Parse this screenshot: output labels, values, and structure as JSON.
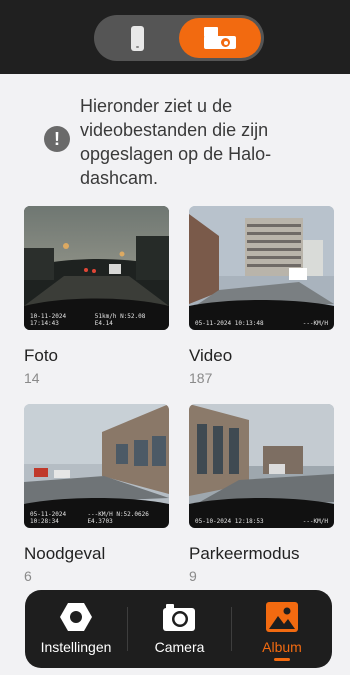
{
  "header": {
    "mode_options": [
      "phone",
      "dashcam"
    ],
    "selected_mode": "dashcam",
    "accent_color": "#f26a10"
  },
  "info": {
    "icon": "exclamation-icon",
    "text": "Hieronder ziet u de videobestanden die zijn opgeslagen op de Halo-dashcam."
  },
  "albums": [
    {
      "title": "Foto",
      "count": "14",
      "stamp_left": "10-11-2024 17:14:43",
      "stamp_right": "51km/h N:52.08 E4.14"
    },
    {
      "title": "Video",
      "count": "187",
      "stamp_left": "05-11-2024 10:13:48",
      "stamp_right": "---KM/H"
    },
    {
      "title": "Noodgeval",
      "count": "6",
      "stamp_left": "05-11-2024 10:28:34",
      "stamp_right": "---KM/H  N:52.0626 E4.3703"
    },
    {
      "title": "Parkeermodus",
      "count": "9",
      "stamp_left": "05-10-2024 12:18:53",
      "stamp_right": "---KM/H"
    }
  ],
  "nav": {
    "items": [
      {
        "label": "Instellingen",
        "icon": "settings-hex-nut-icon"
      },
      {
        "label": "Camera",
        "icon": "camera-icon"
      },
      {
        "label": "Album",
        "icon": "image-icon"
      }
    ],
    "active": "Album"
  }
}
